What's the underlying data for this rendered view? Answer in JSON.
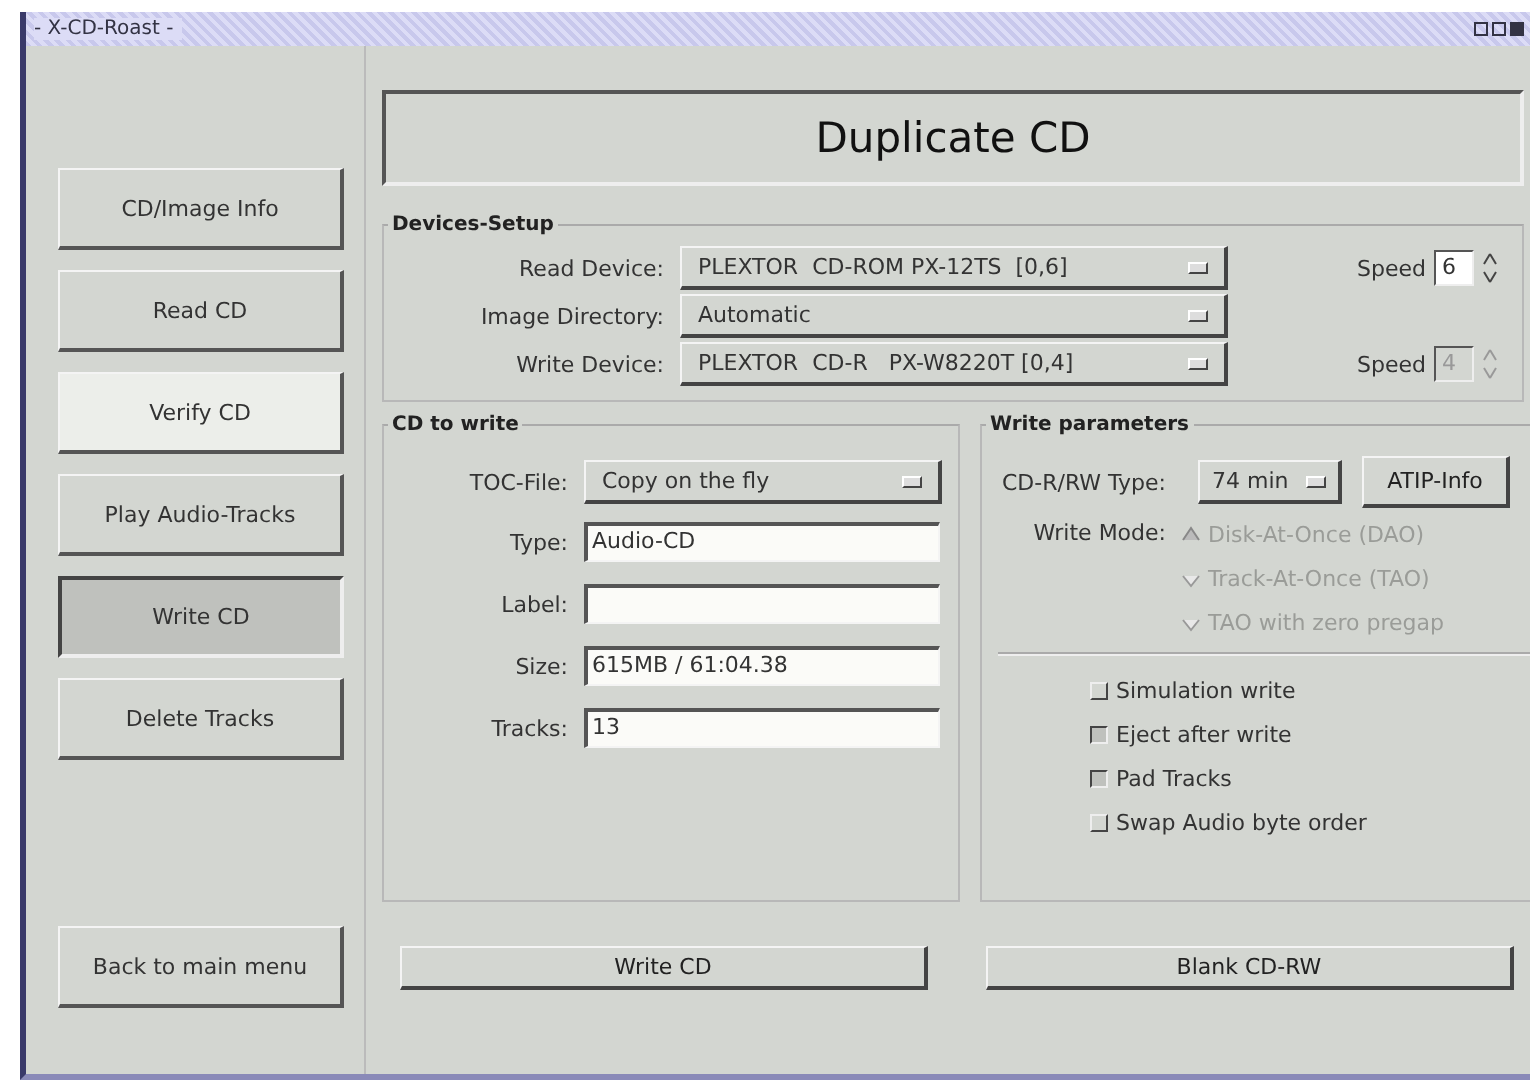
{
  "window": {
    "title": "- X-CD-Roast -"
  },
  "sidebar": {
    "items": [
      {
        "label": "CD/Image Info",
        "selected": false,
        "highlighted": false
      },
      {
        "label": "Read CD",
        "selected": false,
        "highlighted": false
      },
      {
        "label": "Verify CD",
        "selected": false,
        "highlighted": true
      },
      {
        "label": "Play Audio-Tracks",
        "selected": false,
        "highlighted": false
      },
      {
        "label": "Write CD",
        "selected": true,
        "highlighted": false
      },
      {
        "label": "Delete Tracks",
        "selected": false,
        "highlighted": false
      }
    ],
    "back_button": "Back to main menu"
  },
  "header": {
    "title": "Duplicate CD"
  },
  "devices_setup": {
    "title": "Devices-Setup",
    "rows": [
      {
        "label": "Read Device:",
        "value": "PLEXTOR  CD-ROM PX-12TS  [0,6]",
        "speed_label": "Speed",
        "speed": "6",
        "speed_disabled": false
      },
      {
        "label": "Image Directory:",
        "value": "Automatic"
      },
      {
        "label": "Write Device:",
        "value": "PLEXTOR  CD-R   PX-W8220T [0,4]",
        "speed_label": "Speed",
        "speed": "4",
        "speed_disabled": true
      }
    ]
  },
  "cd_to_write": {
    "title": "CD to write",
    "toc_label": "TOC-File:",
    "toc_value": "Copy on the fly",
    "fields": [
      {
        "label": "Type:",
        "value": "Audio-CD"
      },
      {
        "label": "Label:"
      },
      {
        "label": "Size:",
        "value": "615MB / 61:04.38"
      },
      {
        "label": "Tracks:",
        "value": "13"
      }
    ]
  },
  "write_parameters": {
    "title": "Write parameters",
    "type_label": "CD-R/RW Type:",
    "type_value": "74 min",
    "atip_button": "ATIP-Info",
    "mode_label": "Write Mode:",
    "modes": [
      {
        "label": "Disk-At-Once (DAO)",
        "selected": true,
        "disabled": true
      },
      {
        "label": "Track-At-Once (TAO)",
        "selected": false,
        "disabled": true
      },
      {
        "label": "TAO with zero pregap",
        "selected": false,
        "disabled": true
      }
    ],
    "options": [
      {
        "label": "Simulation write",
        "checked": false
      },
      {
        "label": "Eject after write",
        "checked": true
      },
      {
        "label": "Pad Tracks",
        "checked": true
      },
      {
        "label": "Swap Audio byte order",
        "checked": false
      }
    ]
  },
  "buttons": [
    "Write CD",
    "Blank CD-RW"
  ]
}
